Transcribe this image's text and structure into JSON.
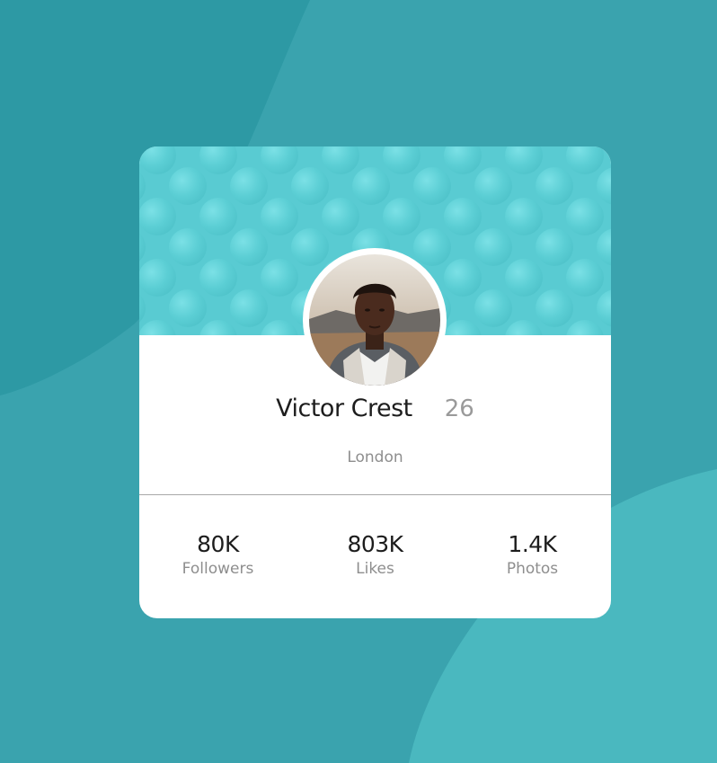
{
  "profile": {
    "name": "Victor Crest",
    "age": "26",
    "location": "London"
  },
  "stats": [
    {
      "value": "80K",
      "label": "Followers"
    },
    {
      "value": "803K",
      "label": "Likes"
    },
    {
      "value": "1.4K",
      "label": "Photos"
    }
  ],
  "colors": {
    "background": "#3aa3ae",
    "accent_header": "#5ccfd5",
    "card": "#ffffff",
    "text_primary": "#1d1d1d",
    "text_muted": "#8e8e8e"
  }
}
